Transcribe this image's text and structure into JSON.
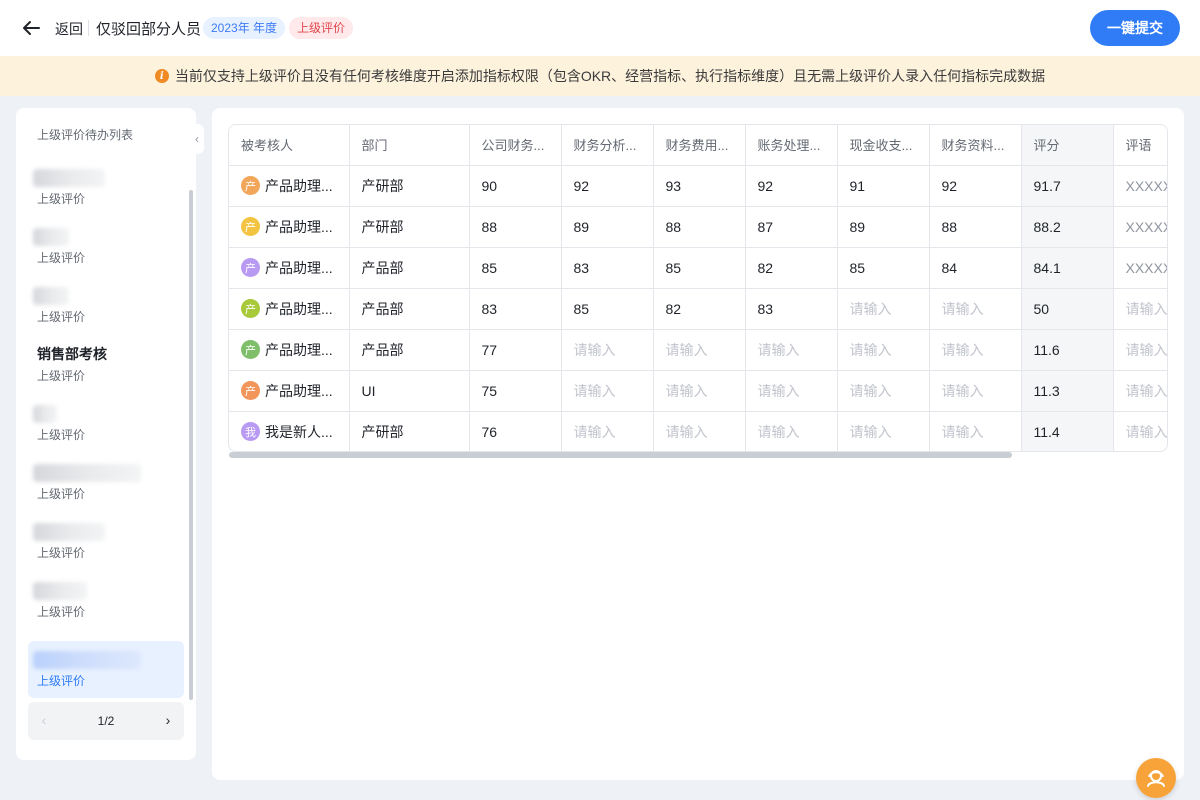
{
  "header": {
    "back_label": "返回",
    "title": "仅驳回部分人员",
    "tag_year": "2023年 年度",
    "tag_type": "上级评价",
    "submit_label": "一键提交"
  },
  "notice": {
    "icon_char": "i",
    "text": "当前仅支持上级评价且没有任何考核维度开启添加指标权限（包含OKR、经营指标、执行指标维度）且无需上级评价人录入任何指标完成数据"
  },
  "sidebar": {
    "title": "上级评价待办列表",
    "items": [
      {
        "name": "",
        "sub": "上级评价",
        "active": false
      },
      {
        "name": "",
        "sub": "上级评价",
        "active": false
      },
      {
        "name": "",
        "sub": "上级评价",
        "active": false
      },
      {
        "name": "销售部考核",
        "sub": "上级评价",
        "active": false
      },
      {
        "name": "",
        "sub": "上级评价",
        "active": false
      },
      {
        "name": "",
        "sub": "上级评价",
        "active": false
      },
      {
        "name": "",
        "sub": "上级评价",
        "active": false
      },
      {
        "name": "",
        "sub": "上级评价",
        "active": false
      },
      {
        "name": "",
        "sub": "上级评价",
        "active": true
      }
    ],
    "collapse_icon": "‹",
    "pager": {
      "prev": "‹",
      "page": "1/2",
      "next": "›"
    }
  },
  "table": {
    "columns": [
      "被考核人",
      "部门",
      "公司财务...",
      "财务分析...",
      "财务费用...",
      "账务处理...",
      "现金收支...",
      "财务资料...",
      "评分",
      "评语"
    ],
    "rows": [
      {
        "avatar_char": "产",
        "avatar_color": "#f2a65a",
        "name": "产品助理...",
        "dept": "产研部",
        "scores": [
          "90",
          "92",
          "93",
          "92",
          "91",
          "92"
        ],
        "total": "91.7",
        "comment": "XXXXXX"
      },
      {
        "avatar_char": "产",
        "avatar_color": "#f3c442",
        "name": "产品助理...",
        "dept": "产研部",
        "scores": [
          "88",
          "89",
          "88",
          "87",
          "89",
          "88"
        ],
        "total": "88.2",
        "comment": "XXXXXX"
      },
      {
        "avatar_char": "产",
        "avatar_color": "#b89af3",
        "name": "产品助理...",
        "dept": "产品部",
        "scores": [
          "85",
          "83",
          "85",
          "82",
          "85",
          "84"
        ],
        "total": "84.1",
        "comment": "XXXXXX"
      },
      {
        "avatar_char": "产",
        "avatar_color": "#a7c93a",
        "name": "产品助理...",
        "dept": "产品部",
        "scores": [
          "83",
          "85",
          "82",
          "83",
          "请输入",
          "请输入"
        ],
        "total": "50",
        "comment": "请输入"
      },
      {
        "avatar_char": "产",
        "avatar_color": "#7fbf6a",
        "name": "产品助理...",
        "dept": "产品部",
        "scores": [
          "77",
          "请输入",
          "请输入",
          "请输入",
          "请输入",
          "请输入"
        ],
        "total": "11.6",
        "comment": "请输入"
      },
      {
        "avatar_char": "产",
        "avatar_color": "#f2955a",
        "name": "产品助理...",
        "dept": "UI",
        "scores": [
          "75",
          "请输入",
          "请输入",
          "请输入",
          "请输入",
          "请输入"
        ],
        "total": "11.3",
        "comment": "请输入"
      },
      {
        "avatar_char": "我",
        "avatar_color": "#b89af3",
        "name": "我是新人...",
        "dept": "产研部",
        "scores": [
          "76",
          "请输入",
          "请输入",
          "请输入",
          "请输入",
          "请输入"
        ],
        "total": "11.4",
        "comment": "请输入"
      }
    ],
    "placeholder": "请输入"
  },
  "colors": {
    "accent": "#2f7cf6",
    "notice_bg": "#fdf2dc",
    "help_fab": "#f7a33a"
  }
}
